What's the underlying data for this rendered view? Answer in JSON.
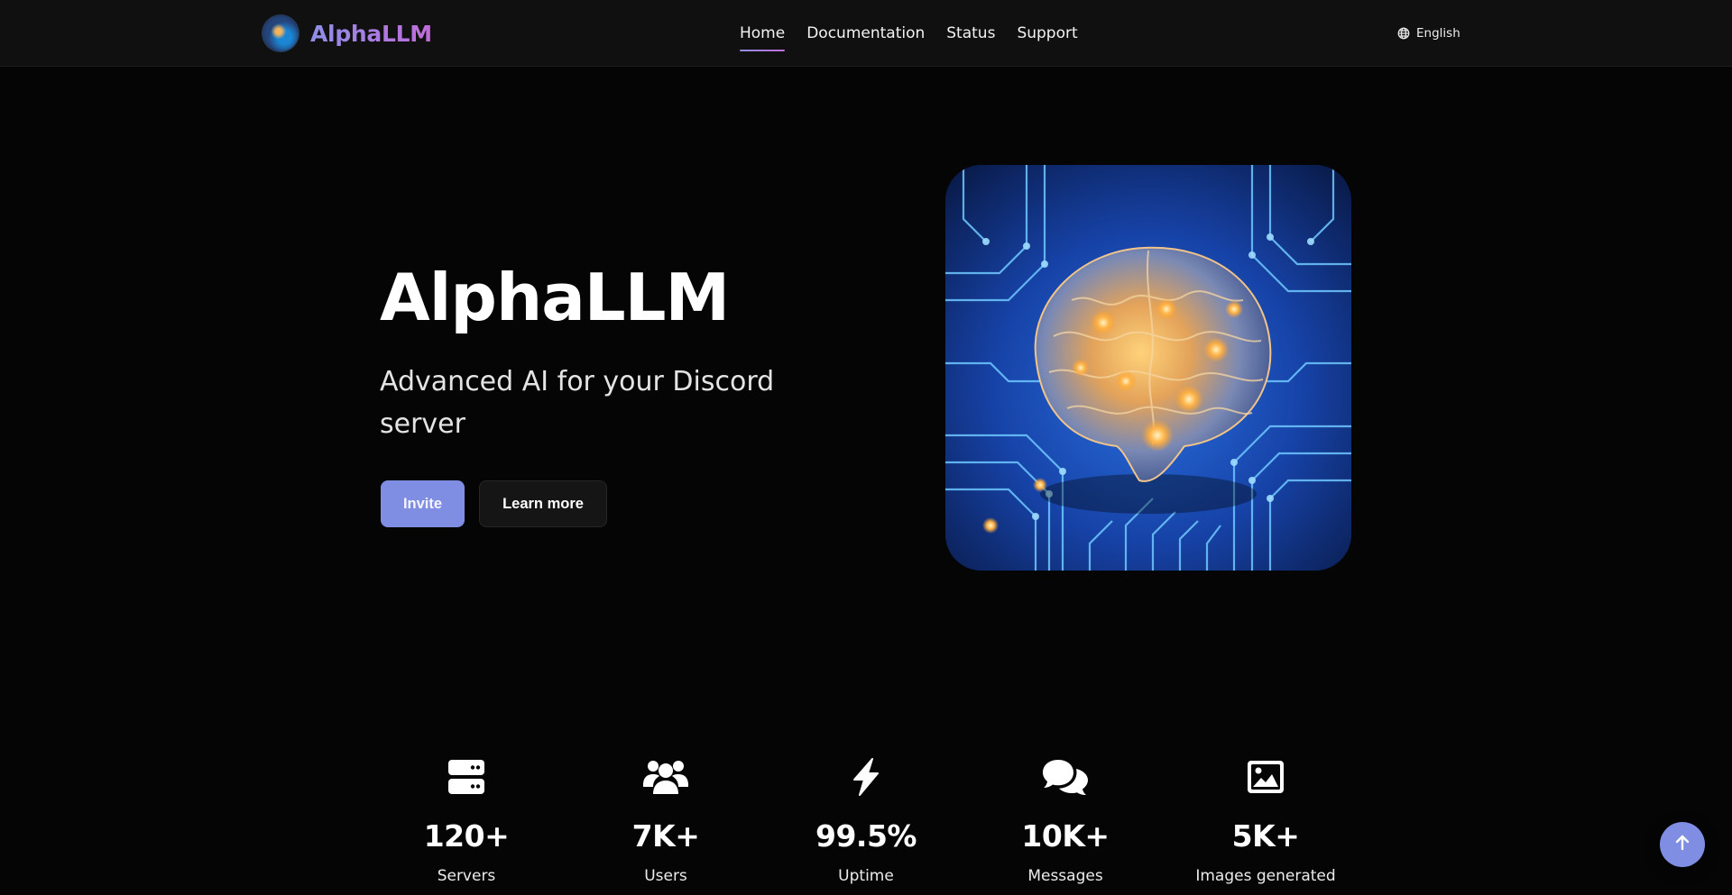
{
  "header": {
    "brand_name": "AlphaLLM",
    "brand_logo_icon": "globe-brain-logo",
    "nav": [
      {
        "label": "Home",
        "active": true
      },
      {
        "label": "Documentation",
        "active": false
      },
      {
        "label": "Status",
        "active": false
      },
      {
        "label": "Support",
        "active": false
      }
    ],
    "language": {
      "icon": "globe-icon",
      "label": "English"
    }
  },
  "hero": {
    "title": "AlphaLLM",
    "subtitle": "Advanced AI for your Discord server",
    "invite_label": "Invite",
    "learn_more_label": "Learn more",
    "image": "brain-on-circuit-board"
  },
  "stats": [
    {
      "icon": "server-icon",
      "value": "120+",
      "label": "Servers"
    },
    {
      "icon": "users-icon",
      "value": "7K+",
      "label": "Users"
    },
    {
      "icon": "bolt-icon",
      "value": "99.5%",
      "label": "Uptime"
    },
    {
      "icon": "comments-icon",
      "value": "10K+",
      "label": "Messages"
    },
    {
      "icon": "image-icon",
      "value": "5K+",
      "label": "Images generated"
    }
  ],
  "back_to_top_icon": "arrow-up-icon",
  "colors": {
    "accent": "#7f8ee3",
    "brand_gradient_start": "#8f8fe8",
    "brand_gradient_end": "#c06bd9",
    "background": "#050505",
    "header_background": "#101010"
  }
}
